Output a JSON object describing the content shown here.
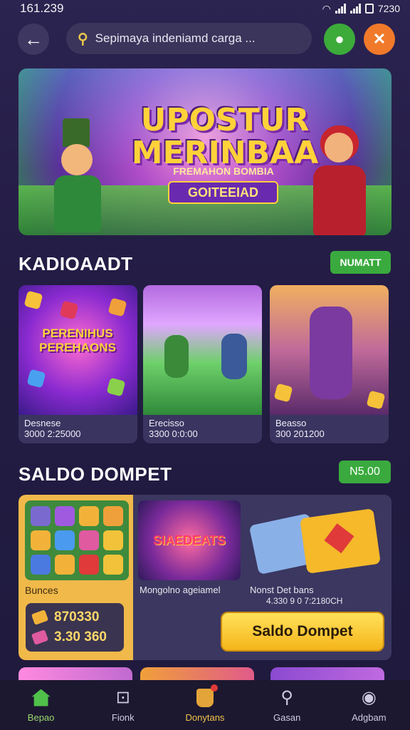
{
  "status": {
    "time": "161.239",
    "battery": "7230"
  },
  "search": {
    "placeholder": "Sepimaya indeniamd carga ..."
  },
  "banner": {
    "title_line1": "UPOSTUR",
    "title_line2": "MERINBAA",
    "subtitle": "FREMAHON BOMBIA",
    "badge": "GOITEEIAD"
  },
  "section1": {
    "title": "KADIOAADT",
    "action": "NUMATT",
    "cards": [
      {
        "art_title": "PERENIHUS PEREHAONS",
        "line1": "Desnese",
        "line2": "3000 2:25000"
      },
      {
        "art_title": "",
        "line1": "Erecisso",
        "line2": "3300 0:0:00"
      },
      {
        "art_title": "",
        "line1": "Beasso",
        "line2": "300 201200"
      }
    ]
  },
  "section2": {
    "title": "SALDO DOMPET",
    "amount": "N5.00",
    "left_label": "Bunces",
    "amount1": "870330",
    "amount2": "3.30 360",
    "promo_title": "SIAEDEATS",
    "promo_label": "Mongolno ageiamel",
    "info1": "Nonst Det bans",
    "info2": "4.330 9 0 7:2180CH",
    "button": "Saldo Dompet"
  },
  "nav": [
    {
      "label": "Bepao",
      "icon": "home-icon"
    },
    {
      "label": "Fionk",
      "icon": "rank-icon"
    },
    {
      "label": "Donytans",
      "icon": "deposit-icon"
    },
    {
      "label": "Gasan",
      "icon": "search-icon"
    },
    {
      "label": "Adgbam",
      "icon": "user-icon"
    }
  ],
  "colors": {
    "accent_green": "#3aaa3e",
    "gold": "#f5b51a",
    "background": "#231c44"
  }
}
